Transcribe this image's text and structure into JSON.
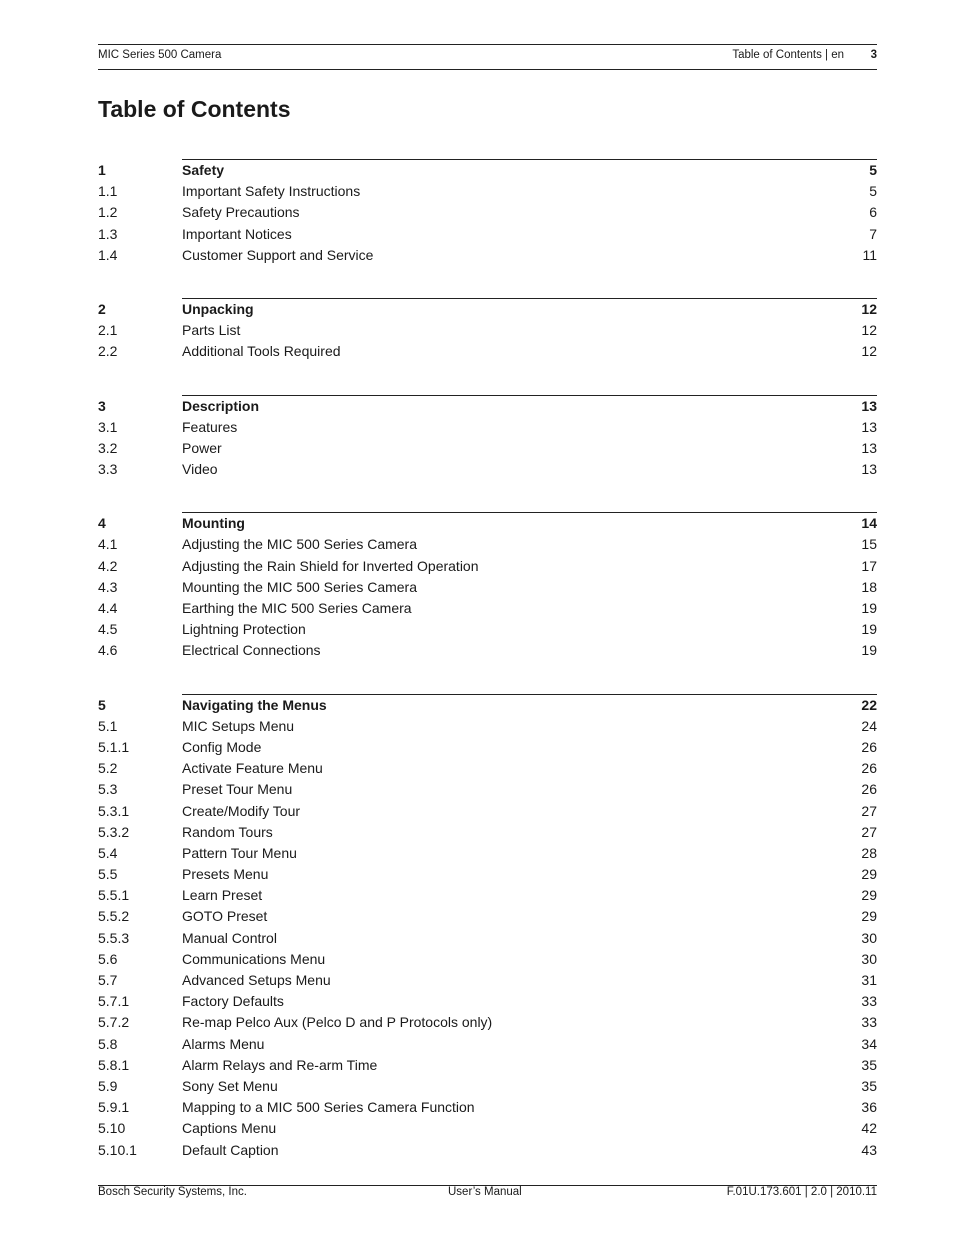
{
  "header": {
    "left": "MIC Series 500 Camera",
    "right": "Table of Contents | en",
    "page_number": "3"
  },
  "title": "Table of Contents",
  "chapters": [
    {
      "num": "1",
      "title": "Safety",
      "page": "5",
      "items": [
        {
          "num": "1.1",
          "title": "Important Safety Instructions",
          "page": "5"
        },
        {
          "num": "1.2",
          "title": "Safety Precautions",
          "page": "6"
        },
        {
          "num": "1.3",
          "title": "Important Notices",
          "page": "7"
        },
        {
          "num": "1.4",
          "title": "Customer Support and Service",
          "page": "11"
        }
      ]
    },
    {
      "num": "2",
      "title": "Unpacking",
      "page": "12",
      "items": [
        {
          "num": "2.1",
          "title": "Parts List",
          "page": "12"
        },
        {
          "num": "2.2",
          "title": "Additional Tools Required",
          "page": "12"
        }
      ]
    },
    {
      "num": "3",
      "title": "Description",
      "page": "13",
      "items": [
        {
          "num": "3.1",
          "title": "Features",
          "page": "13"
        },
        {
          "num": "3.2",
          "title": "Power",
          "page": "13"
        },
        {
          "num": "3.3",
          "title": "Video",
          "page": "13"
        }
      ]
    },
    {
      "num": "4",
      "title": "Mounting",
      "page": "14",
      "items": [
        {
          "num": "4.1",
          "title": "Adjusting the MIC 500 Series Camera",
          "page": "15"
        },
        {
          "num": "4.2",
          "title": "Adjusting the Rain Shield for Inverted Operation",
          "page": "17"
        },
        {
          "num": "4.3",
          "title": "Mounting the MIC 500 Series Camera",
          "page": "18"
        },
        {
          "num": "4.4",
          "title": "Earthing the MIC 500 Series Camera",
          "page": "19"
        },
        {
          "num": "4.5",
          "title": "Lightning Protection",
          "page": "19"
        },
        {
          "num": "4.6",
          "title": "Electrical Connections",
          "page": "19"
        }
      ]
    },
    {
      "num": "5",
      "title": "Navigating the Menus",
      "page": "22",
      "items": [
        {
          "num": "5.1",
          "title": "MIC Setups Menu",
          "page": "24"
        },
        {
          "num": "5.1.1",
          "title": "Config Mode",
          "page": "26"
        },
        {
          "num": "5.2",
          "title": "Activate Feature Menu",
          "page": "26"
        },
        {
          "num": "5.3",
          "title": "Preset Tour Menu",
          "page": "26"
        },
        {
          "num": "5.3.1",
          "title": "Create/Modify Tour",
          "page": "27"
        },
        {
          "num": "5.3.2",
          "title": "Random Tours",
          "page": "27"
        },
        {
          "num": "5.4",
          "title": "Pattern Tour Menu",
          "page": "28"
        },
        {
          "num": "5.5",
          "title": "Presets Menu",
          "page": "29"
        },
        {
          "num": "5.5.1",
          "title": "Learn Preset",
          "page": "29"
        },
        {
          "num": "5.5.2",
          "title": "GOTO Preset",
          "page": "29"
        },
        {
          "num": "5.5.3",
          "title": "Manual Control",
          "page": "30"
        },
        {
          "num": "5.6",
          "title": "Communications Menu",
          "page": "30"
        },
        {
          "num": "5.7",
          "title": "Advanced Setups Menu",
          "page": "31"
        },
        {
          "num": "5.7.1",
          "title": "Factory Defaults",
          "page": "33"
        },
        {
          "num": "5.7.2",
          "title": "Re-map Pelco Aux (Pelco D and P Protocols only)",
          "page": "33"
        },
        {
          "num": "5.8",
          "title": "Alarms Menu",
          "page": "34"
        },
        {
          "num": "5.8.1",
          "title": "Alarm Relays and Re-arm Time",
          "page": "35"
        },
        {
          "num": "5.9",
          "title": "Sony Set Menu",
          "page": "35"
        },
        {
          "num": "5.9.1",
          "title": "Mapping to a MIC 500 Series Camera Function",
          "page": "36"
        },
        {
          "num": "5.10",
          "title": "Captions Menu",
          "page": "42"
        },
        {
          "num": "5.10.1",
          "title": "Default Caption",
          "page": "43"
        }
      ]
    }
  ],
  "footer": {
    "left": "Bosch Security Systems, Inc.",
    "center": "User’s Manual",
    "right": "F.01U.173.601 | 2.0 | 2010.11"
  }
}
